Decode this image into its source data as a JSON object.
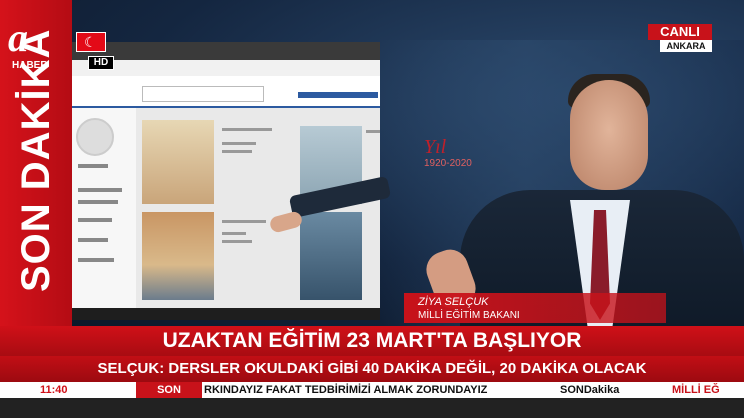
{
  "channel": {
    "logo_letter": "a",
    "logo_sub": "HABER",
    "hd": "HD"
  },
  "sidebar_label": "SON DAKİKA",
  "live": {
    "label": "CANLI",
    "location": "ANKARA"
  },
  "anniversary": {
    "script": "Yıl",
    "years": "1920-2020"
  },
  "guest": {
    "name": "ZİYA SELÇUK",
    "title": "MİLLİ EĞİTİM BAKANI"
  },
  "headline": "UZAKTAN EĞİTİM 23 MART'TA BAŞLIYOR",
  "subheadline": "SELÇUK: DERSLER OKULDAKİ GİBİ 40 DAKİKA DEĞİL, 20 DAKİKA OLACAK",
  "ticker": {
    "time": "11:40",
    "label": "SON DAKİKA",
    "text": "RKINDAYIZ FAKAT TEDBİRİMİZİ ALMAK ZORUNDAYIZ",
    "brand": "SONDakika",
    "right_text": "MİLLİ EĞ"
  },
  "colors": {
    "accent_red": "#c8121a",
    "studio_blue": "#142640"
  }
}
